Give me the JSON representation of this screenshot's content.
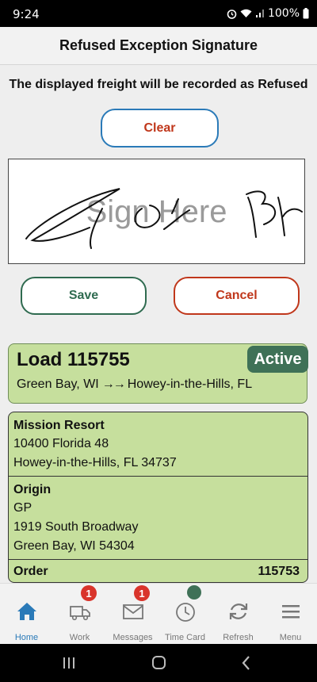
{
  "status_bar": {
    "time": "9:24",
    "battery": "100%"
  },
  "header": {
    "title": "Refused Exception Signature"
  },
  "notice": "The displayed freight will be recorded as Refused",
  "signature": {
    "clear_label": "Clear",
    "placeholder": "Sign Here",
    "save_label": "Save",
    "cancel_label": "Cancel"
  },
  "load": {
    "title": "Load 115755",
    "status": "Active",
    "origin": "Green Bay, WI",
    "arrows": "→→",
    "destination": "Howey-in-the-Hills, FL"
  },
  "stop": {
    "name": "Mission Resort",
    "address1": "10400 Florida 48",
    "address2": "Howey-in-the-Hills, FL 34737",
    "origin_heading": "Origin",
    "origin_name": "GP",
    "origin_address1": "1919 South Broadway",
    "origin_address2": "Green Bay, WI 54304",
    "order_label": "Order",
    "order_number": "115753"
  },
  "nav": {
    "items": [
      {
        "label": "Home",
        "icon": "home-icon",
        "badge": ""
      },
      {
        "label": "Work",
        "icon": "truck-icon",
        "badge": "1"
      },
      {
        "label": "Messages",
        "icon": "envelope-icon",
        "badge": "1"
      },
      {
        "label": "Time Card",
        "icon": "clock-icon",
        "badge": ""
      },
      {
        "label": "Refresh",
        "icon": "refresh-icon",
        "badge": ""
      },
      {
        "label": "Menu",
        "icon": "menu-icon",
        "badge": ""
      }
    ]
  },
  "colors": {
    "accent_blue": "#2a7ab8",
    "danger_red": "#c0371b",
    "brand_green": "#3f7157",
    "card_green": "#c6df9d",
    "badge_red": "#d9342b"
  }
}
